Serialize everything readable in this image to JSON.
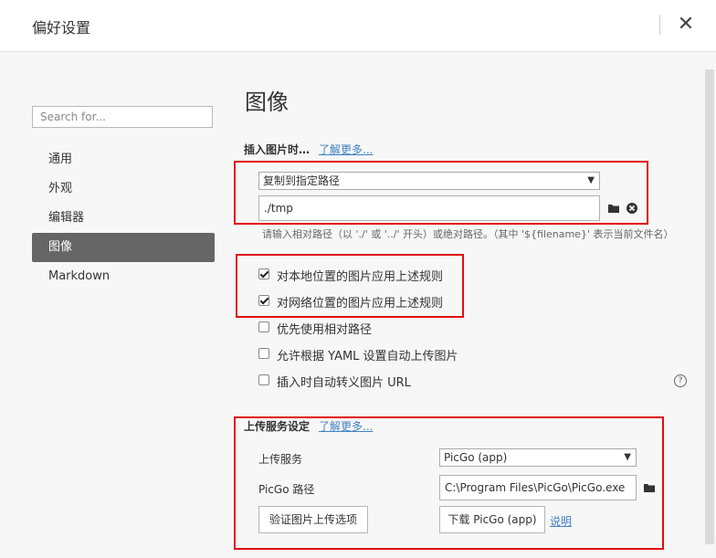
{
  "window": {
    "title": "偏好设置",
    "close_glyph": "✕"
  },
  "sidebar": {
    "search_placeholder": "Search for...",
    "items": [
      {
        "label": "通用",
        "active": false
      },
      {
        "label": "外观",
        "active": false
      },
      {
        "label": "编辑器",
        "active": false
      },
      {
        "label": "图像",
        "active": true
      },
      {
        "label": "Markdown",
        "active": false
      }
    ]
  },
  "main": {
    "heading": "图像",
    "insert_section": {
      "title": "插入图片时…",
      "learn_more": "了解更多...",
      "action_select": "复制到指定路径",
      "path_value": "./tmp",
      "hint": "请输入相对路径（以 './' 或 '../' 开头）或绝对路径。（其中 '${filename}' 表示当前文件名）",
      "checkboxes": [
        {
          "label": "对本地位置的图片应用上述规则",
          "checked": true
        },
        {
          "label": "对网络位置的图片应用上述规则",
          "checked": true
        },
        {
          "label": "优先使用相对路径",
          "checked": false
        },
        {
          "label": "允许根据 YAML 设置自动上传图片",
          "checked": false
        },
        {
          "label": "插入时自动转义图片 URL",
          "checked": false
        }
      ],
      "help_glyph": "?"
    },
    "upload_section": {
      "title": "上传服务设定",
      "learn_more": "了解更多...",
      "service_label": "上传服务",
      "service_value": "PicGo (app)",
      "path_label": "PicGo 路径",
      "path_value": "C:\\Program Files\\PicGo\\PicGo.exe",
      "verify_button": "验证图片上传选项",
      "download_button": "下载 PicGo (app)",
      "explain_link": "说明"
    }
  },
  "colors": {
    "accent_link": "#4183c4",
    "highlight_box": "#e01010",
    "active_nav": "#666666"
  },
  "icons": [
    "close-icon",
    "folder-icon",
    "clear-icon",
    "dropdown-arrow-icon",
    "help-icon",
    "checkbox-icon"
  ]
}
